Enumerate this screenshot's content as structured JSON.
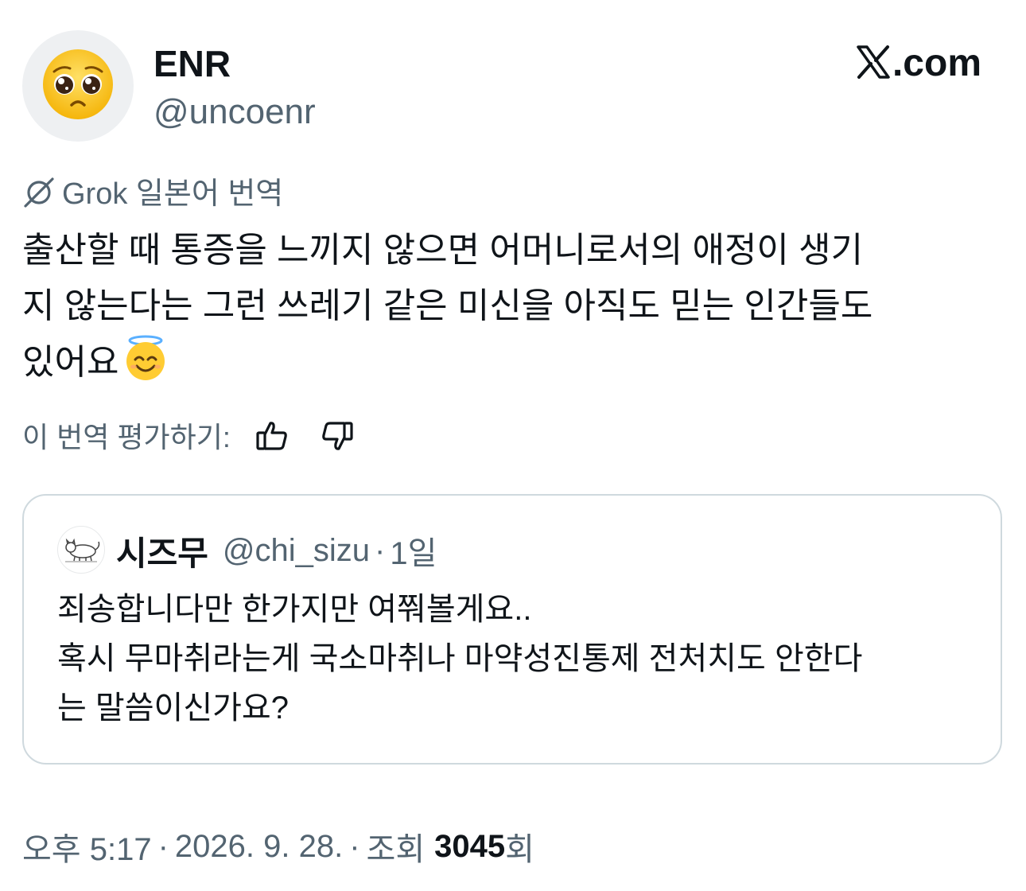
{
  "author": {
    "display_name": "ENR",
    "handle": "@uncoenr",
    "avatar_icon": "pleading-face-emoji"
  },
  "brand": {
    "logo_icon": "x-logo",
    "text": ".com"
  },
  "translation": {
    "label": "Grok 일본어 번역",
    "icon": "grok-icon"
  },
  "tweet": {
    "text": "출산할 때 통증을 느끼지 않으면 어머니로서의 애정이 생기\n지 않는다는 그런 쓰레기 같은 미신을 아직도 믿는 인간들도\n있어요",
    "emoji_icon": "smiling-face-with-halo-emoji"
  },
  "rating": {
    "label": "이 번역 평가하기:",
    "thumbs_up_icon": "thumbs-up-icon",
    "thumbs_down_icon": "thumbs-down-icon"
  },
  "quote": {
    "display_name": "시즈무",
    "handle": "@chi_sizu",
    "separator": "·",
    "time": "1일",
    "avatar_icon": "cat-drawing-avatar",
    "text": "죄송합니다만 한가지만 여쭤볼게요..\n혹시 무마취라는게 국소마취나 마약성진통제 전처치도 안한다\n는 말씀이신가요?"
  },
  "meta": {
    "time": "오후 5:17",
    "sep1": "·",
    "date": "2026. 9. 28.",
    "sep2": "·",
    "views_label": "조회",
    "views_count": "3045",
    "views_suffix": "회"
  },
  "colors": {
    "text_primary": "#0f1419",
    "text_secondary": "#536471",
    "border": "#cfd9de"
  }
}
